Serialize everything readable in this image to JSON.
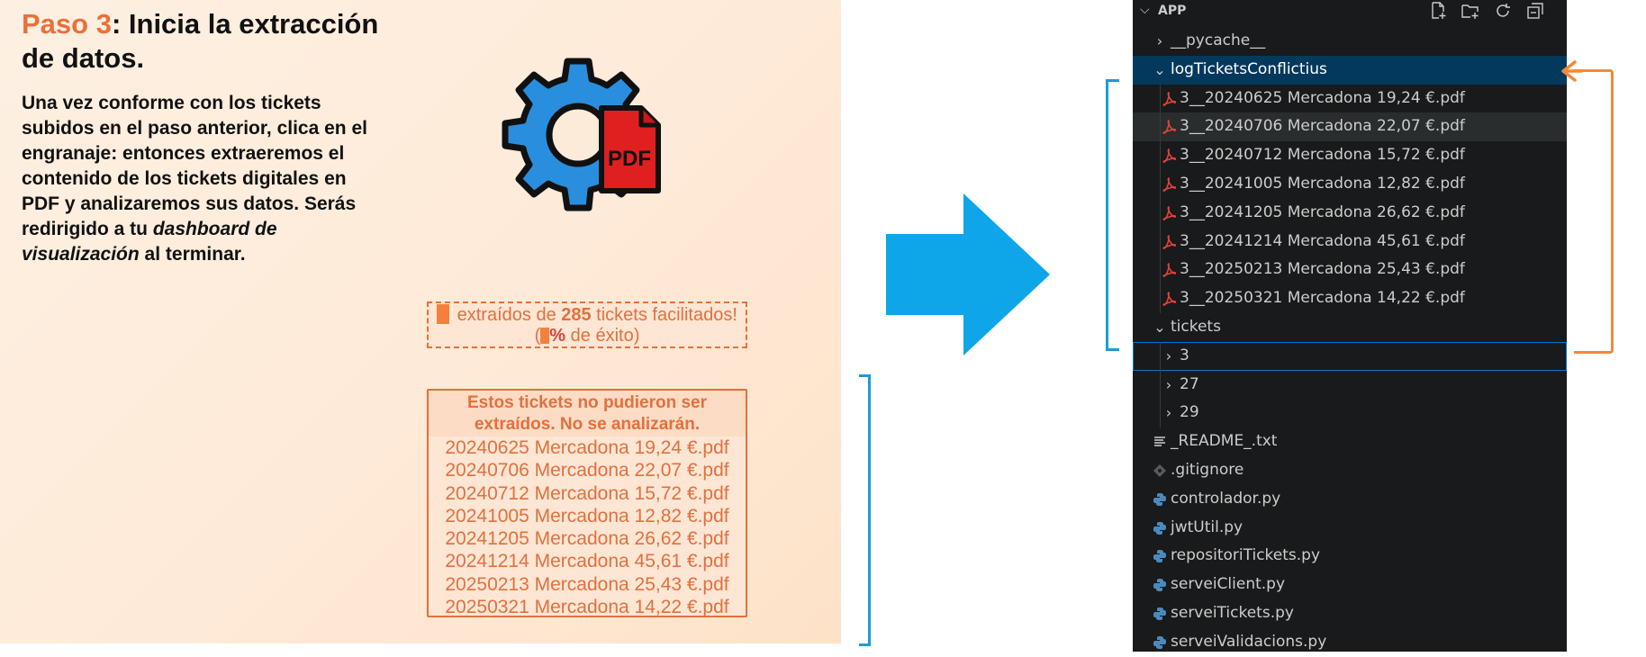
{
  "guide": {
    "title_accent": "Paso 3",
    "title_rest": ": Inicia la extracción de datos.",
    "desc_part1": "Una vez conforme con los tickets subidos en el paso anterior, clica en el engranaje: entonces extraeremos el contenido de los tickets digitales en PDF y analizaremos sus datos. Serás redirigido a tu ",
    "desc_em": "dashboard de visualización",
    "desc_part2": " al terminar.",
    "gear_icon_label": "PDF",
    "stats": {
      "line1_pre": " extraídos de ",
      "total": "285",
      "line1_post": " tickets facilitados!",
      "line2_pre": "(",
      "pct_sign": "%",
      "line2_post": " de éxito)"
    },
    "failed": {
      "heading": "Estos tickets no pudieron ser extraídos. No se analizarán.",
      "files": [
        "20240625 Mercadona 19,24 €.pdf",
        "20240706 Mercadona 22,07 €.pdf",
        "20240712 Mercadona 15,72 €.pdf",
        "20241005 Mercadona 12,82 €.pdf",
        "20241205 Mercadona 26,62 €.pdf",
        "20241214 Mercadona 45,61 €.pdf",
        "20250213 Mercadona 25,43 €.pdf",
        "20250321 Mercadona 14,22 €.pdf"
      ]
    }
  },
  "explorer": {
    "root": "APP",
    "actions": [
      "new-file-icon",
      "new-folder-icon",
      "refresh-icon",
      "collapse-all-icon"
    ],
    "pycache": "__pycache__",
    "log_folder": "logTicketsConflictius",
    "log_files": [
      "3__20240625 Mercadona 19,24 €.pdf",
      "3__20240706 Mercadona 22,07 €.pdf",
      "3__20240712 Mercadona 15,72 €.pdf",
      "3__20241005 Mercadona 12,82 €.pdf",
      "3__20241205 Mercadona 26,62 €.pdf",
      "3__20241214 Mercadona 45,61 €.pdf",
      "3__20250213 Mercadona 25,43 €.pdf",
      "3__20250321 Mercadona 14,22 €.pdf"
    ],
    "tickets_folder": "tickets",
    "ticket_subfolders": [
      "3",
      "27",
      "29"
    ],
    "files": {
      "readme": "_README_.txt",
      "gitignore": ".gitignore",
      "python": [
        "controlador.py",
        "jwtUtil.py",
        "repositoriTickets.py",
        "serveiClient.py",
        "serveiTickets.py",
        "serveiValidacions.py"
      ]
    }
  },
  "colors": {
    "accent_orange": "#e8703a",
    "arrow_blue": "#0ea5e9",
    "bracket_blue": "#1e9ad6",
    "pdf_red": "#e02020",
    "vscode_bg": "#191a1b",
    "selected_row": "#04395e"
  }
}
